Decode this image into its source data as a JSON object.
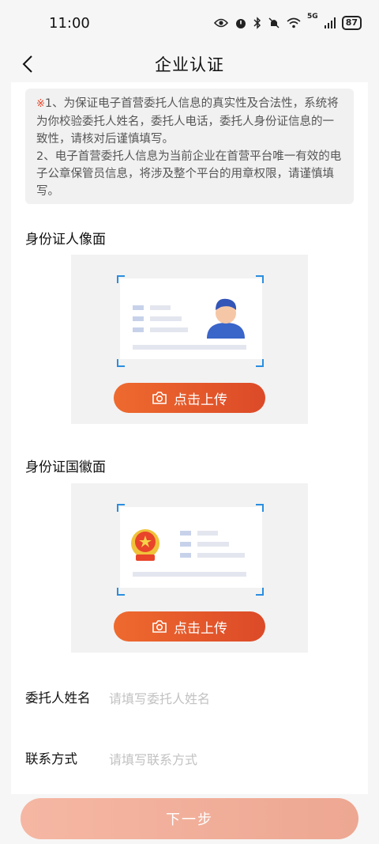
{
  "status_bar": {
    "time": "11:00",
    "network": "5G",
    "battery": "87"
  },
  "header": {
    "title": "企业认证"
  },
  "notice": {
    "star": "※",
    "line1": "1、为保证电子首营委托人信息的真实性及合法性，系统将为你校验委托人姓名，委托人电话，委托人身份证信息的一致性，请核对后谨慎填写。",
    "line2": "2、电子首营委托人信息为当前企业在首营平台唯一有效的电子公章保管员信息，将涉及整个平台的用章权限，请谨慎填写。"
  },
  "id_front": {
    "label": "身份证人像面",
    "upload_label": "点击上传"
  },
  "id_back": {
    "label": "身份证国徽面",
    "upload_label": "点击上传"
  },
  "form": {
    "name_label": "委托人姓名",
    "name_placeholder": "请填写委托人姓名",
    "contact_label": "联系方式",
    "contact_placeholder": "请填写联系方式"
  },
  "footer": {
    "next_label": "下一步"
  },
  "colors": {
    "accent": "#e5572b",
    "bracket": "#2a8ee0",
    "next_disabled": "#f1ae9a"
  }
}
